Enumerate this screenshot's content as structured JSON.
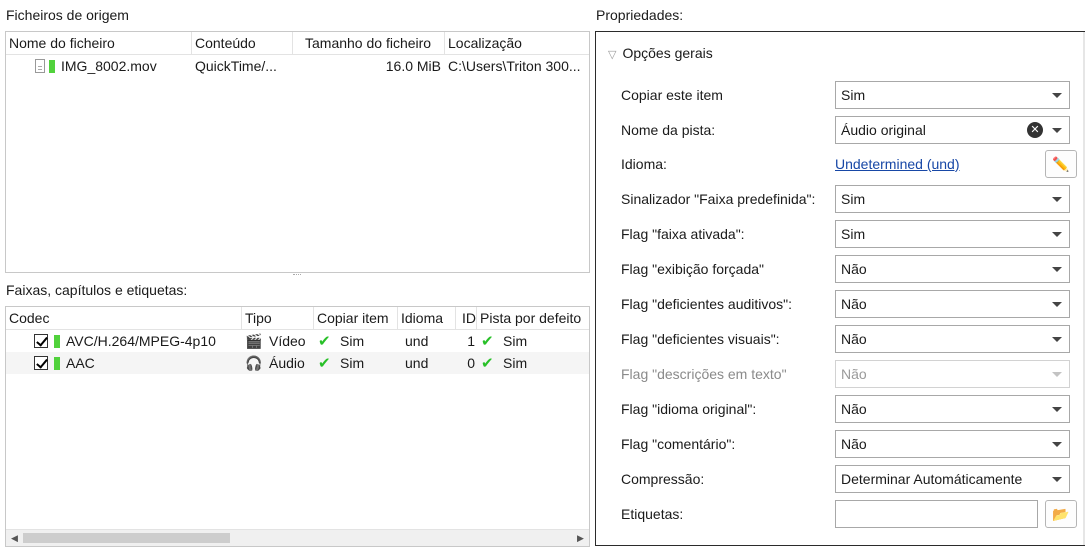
{
  "source_files": {
    "title": "Ficheiros de origem",
    "columns": [
      "Nome do ficheiro",
      "Conteúdo",
      "Tamanho do ficheiro",
      "Localização"
    ],
    "rows": [
      {
        "name": "IMG_8002.mov",
        "content": "QuickTime/...",
        "size": "16.0 MiB",
        "location": "C:\\Users\\Triton 300..."
      }
    ]
  },
  "tracks": {
    "title": "Faixas, capítulos e etiquetas:",
    "columns": [
      "Codec",
      "Tipo",
      "Copiar item",
      "Idioma",
      "ID",
      "Pista por defeito"
    ],
    "rows": [
      {
        "codec": "AVC/H.264/MPEG-4p10",
        "type": "Vídeo",
        "type_icon": "🎬",
        "copy": "Sim",
        "language": "und",
        "id": "1",
        "default": "Sim"
      },
      {
        "codec": "AAC",
        "type": "Áudio",
        "type_icon": "🎧",
        "copy": "Sim",
        "language": "und",
        "id": "0",
        "default": "Sim"
      }
    ]
  },
  "properties": {
    "title": "Propriedades:",
    "group": "Opções gerais",
    "copy_item": {
      "label": "Copiar este item",
      "value": "Sim"
    },
    "track_name": {
      "label": "Nome da pista:",
      "value": "Áudio original"
    },
    "language": {
      "label": "Idioma:",
      "value": "Undetermined (und)"
    },
    "default_flag": {
      "label": "Sinalizador \"Faixa predefinida\":",
      "value": "Sim"
    },
    "enabled_flag": {
      "label": "Flag \"faixa ativada\":",
      "value": "Sim"
    },
    "forced_flag": {
      "label": "Flag \"exibição forçada\"",
      "value": "Não"
    },
    "hearing_flag": {
      "label": "Flag \"deficientes auditivos\":",
      "value": "Não"
    },
    "visual_flag": {
      "label": "Flag \"deficientes visuais\":",
      "value": "Não"
    },
    "text_desc_flag": {
      "label": "Flag \"descrições em texto\"",
      "value": "Não"
    },
    "original_lang_flag": {
      "label": "Flag \"idioma original\":",
      "value": "Não"
    },
    "commentary_flag": {
      "label": "Flag \"comentário\":",
      "value": "Não"
    },
    "compression": {
      "label": "Compressão:",
      "value": "Determinar Automáticamente"
    },
    "tags": {
      "label": "Etiquetas:",
      "value": ""
    }
  },
  "colors": {
    "accent_green": "#51d23c",
    "check_green": "#28c028",
    "link": "#1747a6"
  }
}
